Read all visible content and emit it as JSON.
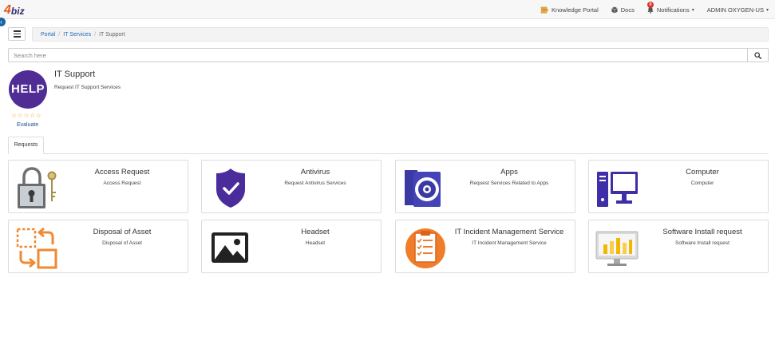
{
  "app": {
    "logo_number": "4",
    "logo_text": "biz"
  },
  "topnav": {
    "knowledge_portal": "Knowledge Portal",
    "docs": "Docs",
    "notifications": "Notifications",
    "notification_count": "0",
    "user": "ADMIN OXYGEN-US"
  },
  "breadcrumb": {
    "portal": "Portal",
    "it_services": "IT Services",
    "current": "IT Support",
    "separator": "/"
  },
  "search": {
    "placeholder": "Search here",
    "value": ""
  },
  "header": {
    "logo_text": "HELP",
    "title": "IT Support",
    "subtitle": "Request IT Support Services",
    "stars": "☆☆☆☆☆",
    "rating": 0,
    "rating_max": 5,
    "evaluate": "Evaluate"
  },
  "tabs": [
    {
      "label": "Requests",
      "active": true
    }
  ],
  "cards": [
    {
      "title": "Access Request",
      "description": "Access Request",
      "icon": "padlock-key-icon"
    },
    {
      "title": "Antivirus",
      "description": "Request Antivirus Services",
      "icon": "shield-check-icon"
    },
    {
      "title": "Apps",
      "description": "Request Services Related to Apps",
      "icon": "cd-case-icon"
    },
    {
      "title": "Computer",
      "description": "Computer",
      "icon": "desktop-computer-icon"
    },
    {
      "title": "Disposal of Asset",
      "description": "Disposal of Asset",
      "icon": "transfer-arrows-icon"
    },
    {
      "title": "Headset",
      "description": "Headset",
      "icon": "image-icon"
    },
    {
      "title": "IT Incident Management Service",
      "description": "IT Incident Management Service",
      "icon": "checklist-icon"
    },
    {
      "title": "Software Install request",
      "description": "Software Install request",
      "icon": "monitor-chart-icon"
    }
  ],
  "colors": {
    "accent": "#1d6bb5",
    "help_logo": "#4f2d95",
    "antivirus_shield": "#4a2c9a",
    "apps_blue": "#3b3aa5",
    "computer_blue": "#3e2fa8",
    "disposal_orange": "#ef8a33",
    "incident_orange": "#ef7d2a",
    "stars": "#e7a12f"
  }
}
